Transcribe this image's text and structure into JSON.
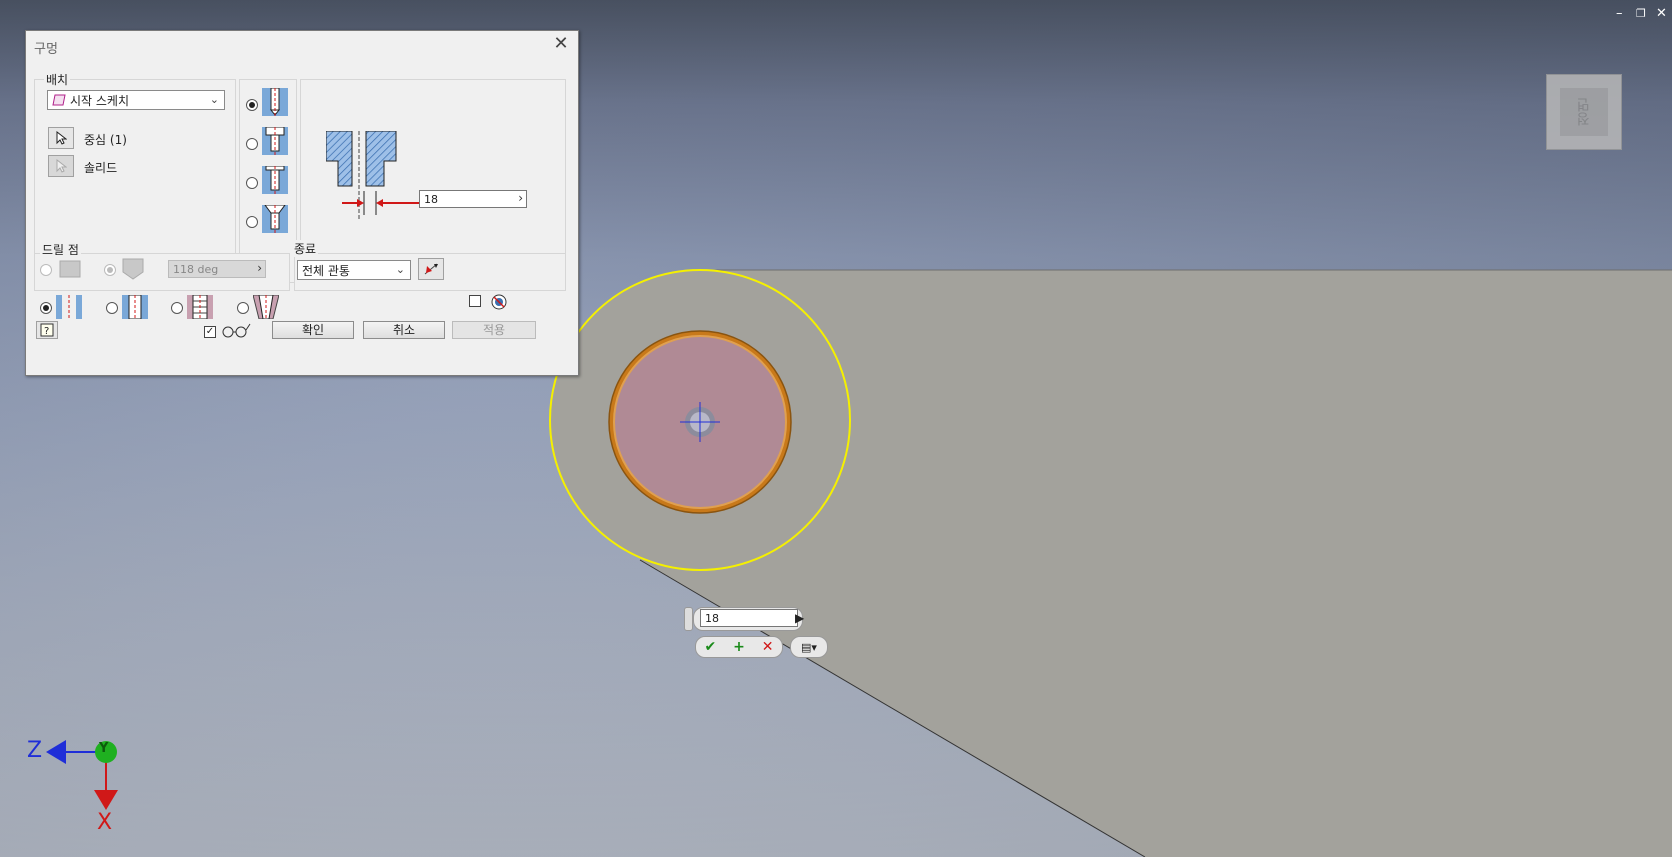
{
  "dialog": {
    "title": "구멍",
    "close": "✕",
    "placement": {
      "label": "배치",
      "type_value": "시작 스케치",
      "center_label": "중심 (1)",
      "solid_label": "솔리드"
    },
    "diameter_value": "18",
    "drill_point": {
      "label": "드릴 점",
      "angle_value": "118 deg"
    },
    "termination": {
      "label": "종료",
      "value": "전체 관통"
    },
    "buttons": {
      "ok": "확인",
      "cancel": "취소",
      "apply": "적용"
    }
  },
  "mini_toolbar": {
    "value": "18",
    "ok": "✔",
    "add": "+",
    "cancel": "✕"
  },
  "viewcube": {
    "face_label": "정면"
  },
  "axes": {
    "z": "Z",
    "y": "Y",
    "x": "X"
  },
  "window_controls": {
    "minimize": "–",
    "restore": "❐",
    "close": "✕"
  },
  "colors": {
    "part_face": "#a3a29c",
    "hole_preview": "#b08a95",
    "selection_yellow": "#f5f000",
    "hole_rim": "#d98a20",
    "axis_z": "#1f2ed8",
    "axis_y": "#1fb020",
    "axis_x": "#d01818"
  }
}
